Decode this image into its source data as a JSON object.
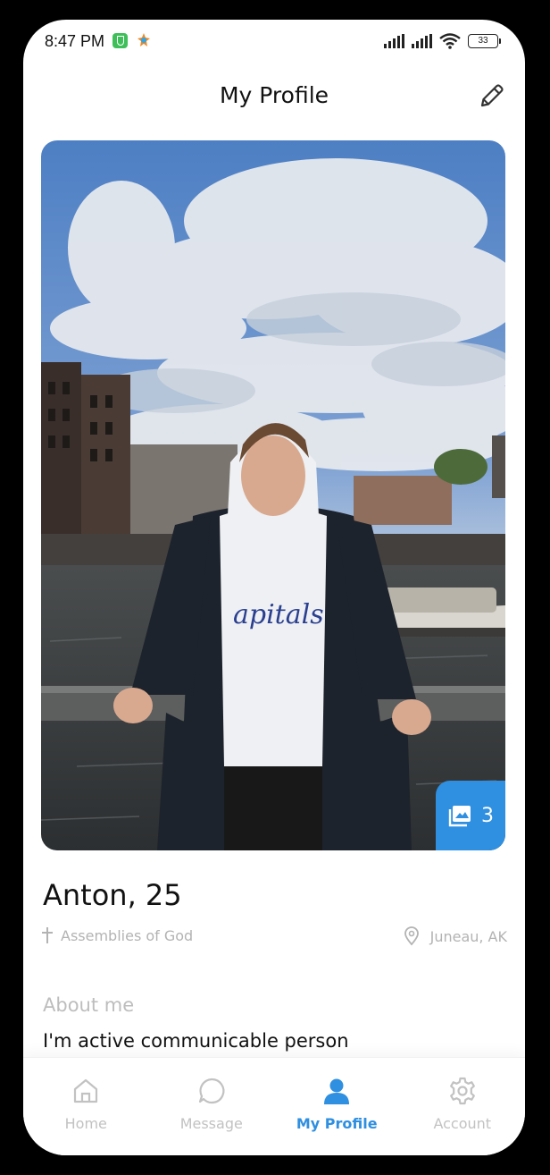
{
  "status_bar": {
    "time": "8:47 PM",
    "battery": "33"
  },
  "header": {
    "title": "My Profile"
  },
  "photo": {
    "gallery_count": "3"
  },
  "profile": {
    "name_age": "Anton, 25",
    "religion": "Assemblies of God",
    "location": "Juneau, AK",
    "about_title": "About me",
    "about_text": "I'm active communicable person"
  },
  "nav": {
    "items": [
      {
        "label": "Home",
        "icon": "home-icon"
      },
      {
        "label": "Message",
        "icon": "message-icon"
      },
      {
        "label": "My Profile",
        "icon": "profile-icon"
      },
      {
        "label": "Account",
        "icon": "gear-icon"
      }
    ],
    "active_index": 2
  },
  "colors": {
    "accent": "#2f8fe0",
    "muted": "#b3b3b3",
    "text": "#111111"
  }
}
